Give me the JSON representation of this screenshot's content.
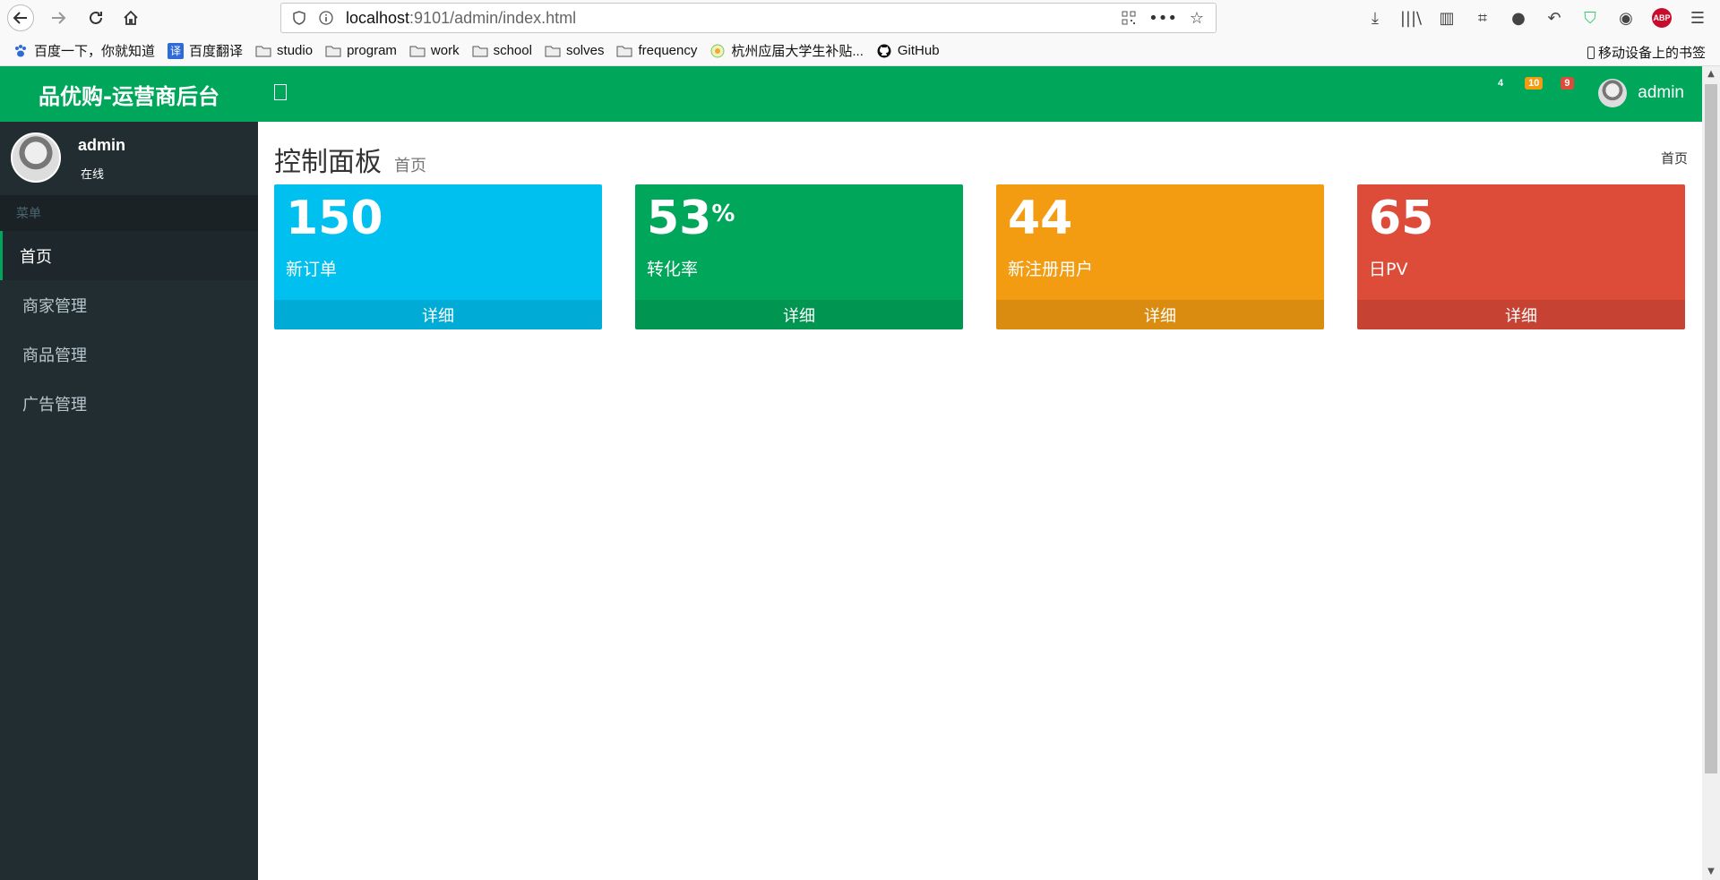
{
  "browser": {
    "url_host": "localhost",
    "url_rest": ":9101/admin/index.html",
    "bookmarks": [
      {
        "label": "百度一下，你就知道",
        "icon": "baidu-icon"
      },
      {
        "label": "百度翻译",
        "icon": "translate-icon"
      },
      {
        "label": "studio",
        "icon": "folder-icon"
      },
      {
        "label": "program",
        "icon": "folder-icon"
      },
      {
        "label": "work",
        "icon": "folder-icon"
      },
      {
        "label": "school",
        "icon": "folder-icon"
      },
      {
        "label": "solves",
        "icon": "folder-icon"
      },
      {
        "label": "frequency",
        "icon": "folder-icon"
      },
      {
        "label": "杭州应届大学生补贴...",
        "icon": "site-icon"
      },
      {
        "label": "GitHub",
        "icon": "github-icon"
      }
    ],
    "mobile_bookmarks": "移动设备上的书签",
    "abp_label": "ABP",
    "translate_glyph": "译"
  },
  "app": {
    "logo": "品优购-运营商后台",
    "user": {
      "name": "admin",
      "status": "在线"
    },
    "menu_header": "菜单",
    "menu": [
      {
        "label": "首页",
        "active": true
      },
      {
        "label": "商家管理",
        "active": false
      },
      {
        "label": "商品管理",
        "active": false
      },
      {
        "label": "广告管理",
        "active": false
      }
    ],
    "topbar": {
      "badges": [
        {
          "value": "4",
          "color": "#00a65a"
        },
        {
          "value": "10",
          "color": "#f39c12"
        },
        {
          "value": "9",
          "color": "#dd4b39"
        }
      ],
      "user_name": "admin"
    },
    "content": {
      "title": "控制面板",
      "subtitle": "首页",
      "breadcrumb": "首页",
      "boxes": [
        {
          "value": "150",
          "suffix": "",
          "label": "新订单",
          "footer": "详细",
          "color": "#00c0ef"
        },
        {
          "value": "53",
          "suffix": "%",
          "label": "转化率",
          "footer": "详细",
          "color": "#00a65a"
        },
        {
          "value": "44",
          "suffix": "",
          "label": "新注册用户",
          "footer": "详细",
          "color": "#f39c12"
        },
        {
          "value": "65",
          "suffix": "",
          "label": "日PV",
          "footer": "详细",
          "color": "#dd4b39"
        }
      ]
    }
  },
  "colors": {
    "brand_green": "#00a65a",
    "sidebar_bg": "#222d32"
  }
}
